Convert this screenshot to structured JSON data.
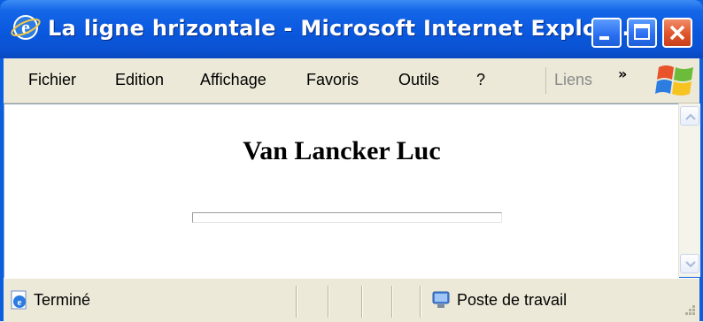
{
  "window": {
    "title": "La ligne hrizontale - Microsoft Internet Explor..."
  },
  "menu": {
    "items": [
      "Fichier",
      "Edition",
      "Affichage",
      "Favoris",
      "Outils",
      "?"
    ],
    "links_label": "Liens",
    "chevron": "»"
  },
  "page": {
    "heading": "Van Lancker Luc"
  },
  "status": {
    "text": "Terminé",
    "zone": "Poste de travail"
  },
  "colors": {
    "titlebar": "#0a58de",
    "close_button": "#e0542a",
    "chrome": "#ece9d8"
  }
}
